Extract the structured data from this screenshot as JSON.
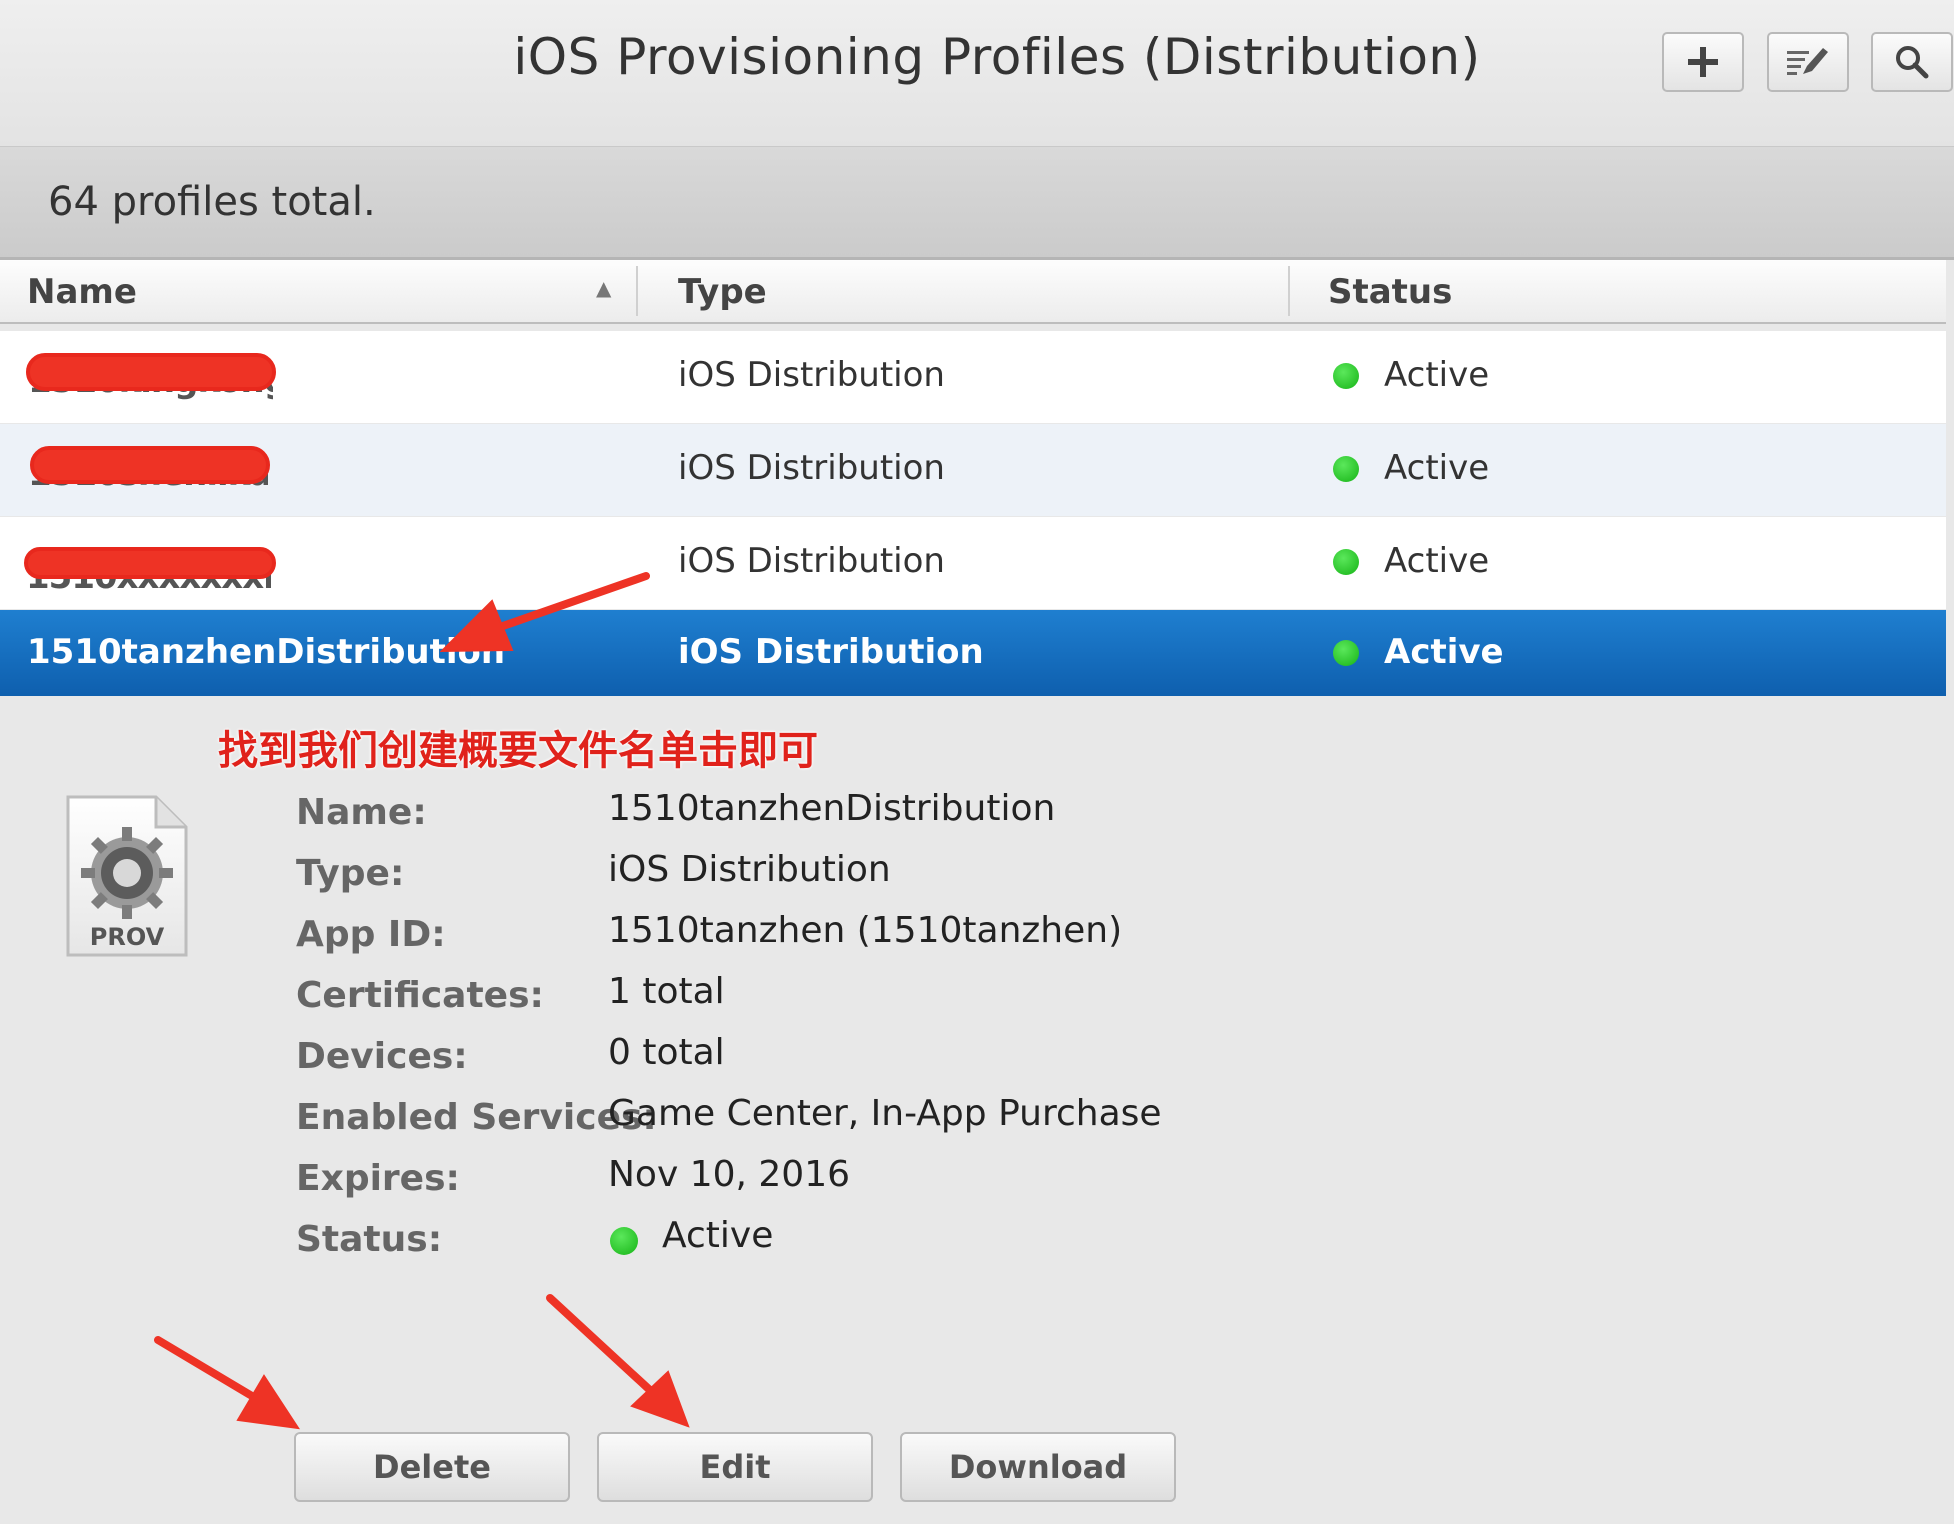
{
  "header": {
    "title": "iOS Provisioning Profiles (Distribution)"
  },
  "toolbar": {
    "add_icon": "plus-icon",
    "edit_icon": "edit-list-icon",
    "search_icon": "search-icon"
  },
  "summary": {
    "count_text": "64 profiles total."
  },
  "table": {
    "columns": [
      "Name",
      "Type",
      "Status"
    ],
    "sort_indicator": "▲",
    "rows": [
      {
        "name": "1510kingkong",
        "type": "iOS Distribution",
        "status": "Active",
        "redacted": true
      },
      {
        "name": "1510shenlikai",
        "type": "iOS Distribution",
        "status": "Active",
        "redacted": true
      },
      {
        "name": "1510xxxxxxxng",
        "type": "iOS Distribution",
        "status": "Active",
        "redacted": true
      },
      {
        "name": "1510tanzhenDistribution",
        "type": "iOS Distribution",
        "status": "Active",
        "selected": true
      }
    ]
  },
  "annotation": {
    "note": "找到我们创建概要文件名单击即可",
    "color": "#e0221b"
  },
  "detail": {
    "icon_label": "PROV",
    "fields": [
      {
        "label": "Name:",
        "value": "1510tanzhenDistribution"
      },
      {
        "label": "Type:",
        "value": "iOS Distribution"
      },
      {
        "label": "App ID:",
        "value": "1510tanzhen (1510tanzhen)"
      },
      {
        "label": "Certificates:",
        "value": "1 total"
      },
      {
        "label": "Devices:",
        "value": "0 total"
      },
      {
        "label": "Enabled Services:",
        "value": "Game Center, In-App Purchase"
      },
      {
        "label": "Expires:",
        "value": "Nov 10, 2016"
      },
      {
        "label": "Status:",
        "value": "Active"
      }
    ]
  },
  "actions": {
    "delete": "Delete",
    "edit": "Edit",
    "download": "Download"
  },
  "colors": {
    "selection": "#1370c0",
    "active_dot": "#1fbf1f",
    "annotation_red": "#ee3325"
  }
}
